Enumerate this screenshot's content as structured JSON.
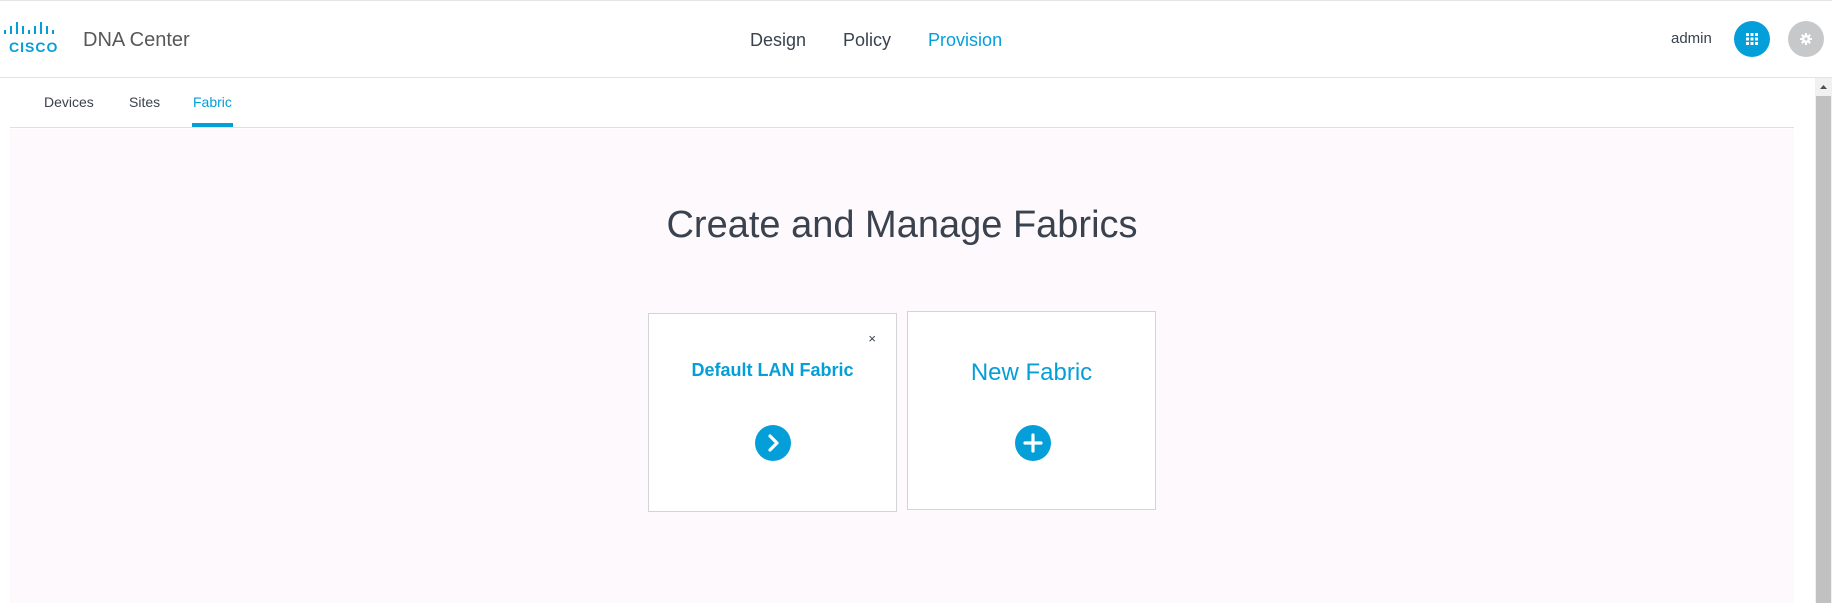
{
  "header": {
    "logo_text": "CISCO",
    "product_name": "DNA Center",
    "nav": [
      {
        "label": "Design",
        "active": false
      },
      {
        "label": "Policy",
        "active": false
      },
      {
        "label": "Provision",
        "active": true
      }
    ],
    "user": "admin",
    "icons": {
      "apps": "apps-grid-icon",
      "settings": "gear-icon"
    }
  },
  "subnav": {
    "tabs": [
      {
        "label": "Devices",
        "active": false
      },
      {
        "label": "Sites",
        "active": false
      },
      {
        "label": "Fabric",
        "active": true
      }
    ]
  },
  "main": {
    "title": "Create and Manage Fabrics",
    "cards": [
      {
        "title": "Default LAN Fabric",
        "close_symbol": "×",
        "icon": "chevron-right-icon"
      },
      {
        "title": "New Fabric",
        "icon": "plus-icon"
      }
    ]
  },
  "colors": {
    "accent": "#049fd9",
    "text": "#39424e",
    "content_bg": "#fdf9fc",
    "settings_bg": "#c7c8ca"
  }
}
